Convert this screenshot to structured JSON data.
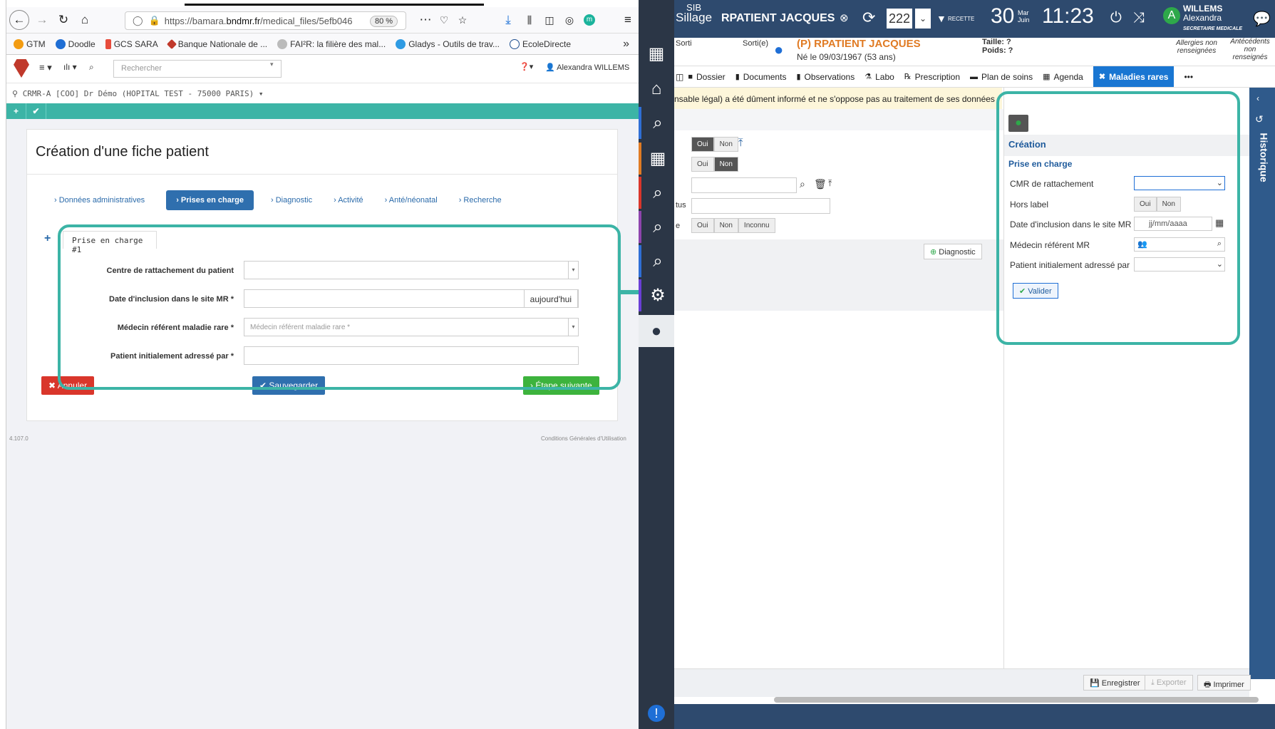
{
  "browser": {
    "url_prefix": "https://bamara.",
    "url_domain": "bndmr.fr",
    "url_path": "/medical_files/5efb046",
    "zoom": "80 %"
  },
  "bookmarks": [
    "GTM",
    "Doodle",
    "GCS SARA",
    "Banque Nationale de ...",
    "FAI²R: la filière des mal...",
    "Gladys - Outils de trav...",
    "EcoleDirecte"
  ],
  "bamara": {
    "search_placeholder": "Rechercher",
    "user": "Alexandra WILLEMS",
    "context": "CRMR-A [COO] Dr Démo (HOPITAL TEST - 75000 PARIS)",
    "title": "Création d'une fiche patient",
    "steps": [
      "Données administratives",
      "Prises en charge",
      "Diagnostic",
      "Activité",
      "Anté/néonatal",
      "Recherche"
    ],
    "tab": "Prise en charge #1",
    "fields": [
      {
        "label": "Centre de rattachement du patient",
        "placeholder": ""
      },
      {
        "label": "Date d'inclusion dans le site MR *",
        "addon": "aujourd'hui"
      },
      {
        "label": "Médecin référent maladie rare *",
        "placeholder": "Médecin référent maladie rare *"
      },
      {
        "label": "Patient initialement adressé par *",
        "placeholder": ""
      }
    ],
    "btn_cancel": "Annuler",
    "btn_save": "Sauvegarder",
    "btn_next": "Étape suivante",
    "version": "4.107.0",
    "cgu": "Conditions Générales d'Utilisation"
  },
  "sillage": {
    "logo_top": "SIB",
    "logo": "Sillage",
    "patient": "RPATIENT JACQUES",
    "count": "222",
    "env": "RECETTE",
    "day": "30",
    "month": "Mar",
    "month2": "Juin",
    "time": "11:23",
    "user_name": "WILLEMS",
    "user_first": "Alexandra",
    "user_role": "SECRETAIRE MEDICALE",
    "avatar": "A",
    "status_sorti": "Sorti",
    "status_sortie": "Sorti(e)",
    "patient_full": "(P) RPATIENT JACQUES",
    "born": "Né le 09/03/1967 (53 ans)",
    "taille": "Taille: ?",
    "poids": "Poids: ?",
    "allergies": "Allergies non renseignées",
    "antecedents": "Antécédents non renseignés",
    "menu": [
      "Dossier",
      "Documents",
      "Observations",
      "Labo",
      "Prescription",
      "Plan de soins",
      "Agenda",
      "Maladies rares"
    ],
    "warning": "nsable légal) a été dûment informé et ne s'oppose pas au traitement de ses données",
    "oui": "Oui",
    "non": "Non",
    "inconnu": "Inconnu",
    "tus": "tus",
    "e": "e",
    "diagnostic_btn": "Diagnostic",
    "creation": "Création",
    "prise": "Prise en charge",
    "rp_fields": [
      "CMR de rattachement",
      "Hors label",
      "Date d'inclusion dans le site MR",
      "Médecin référent MR",
      "Patient initialement adressé par"
    ],
    "date_placeholder": "jj/mm/aaaa",
    "valider": "Valider",
    "historique": "Historique",
    "enregistrer": "Enregistrer",
    "exporter": "Exporter",
    "imprimer": "Imprimer"
  }
}
